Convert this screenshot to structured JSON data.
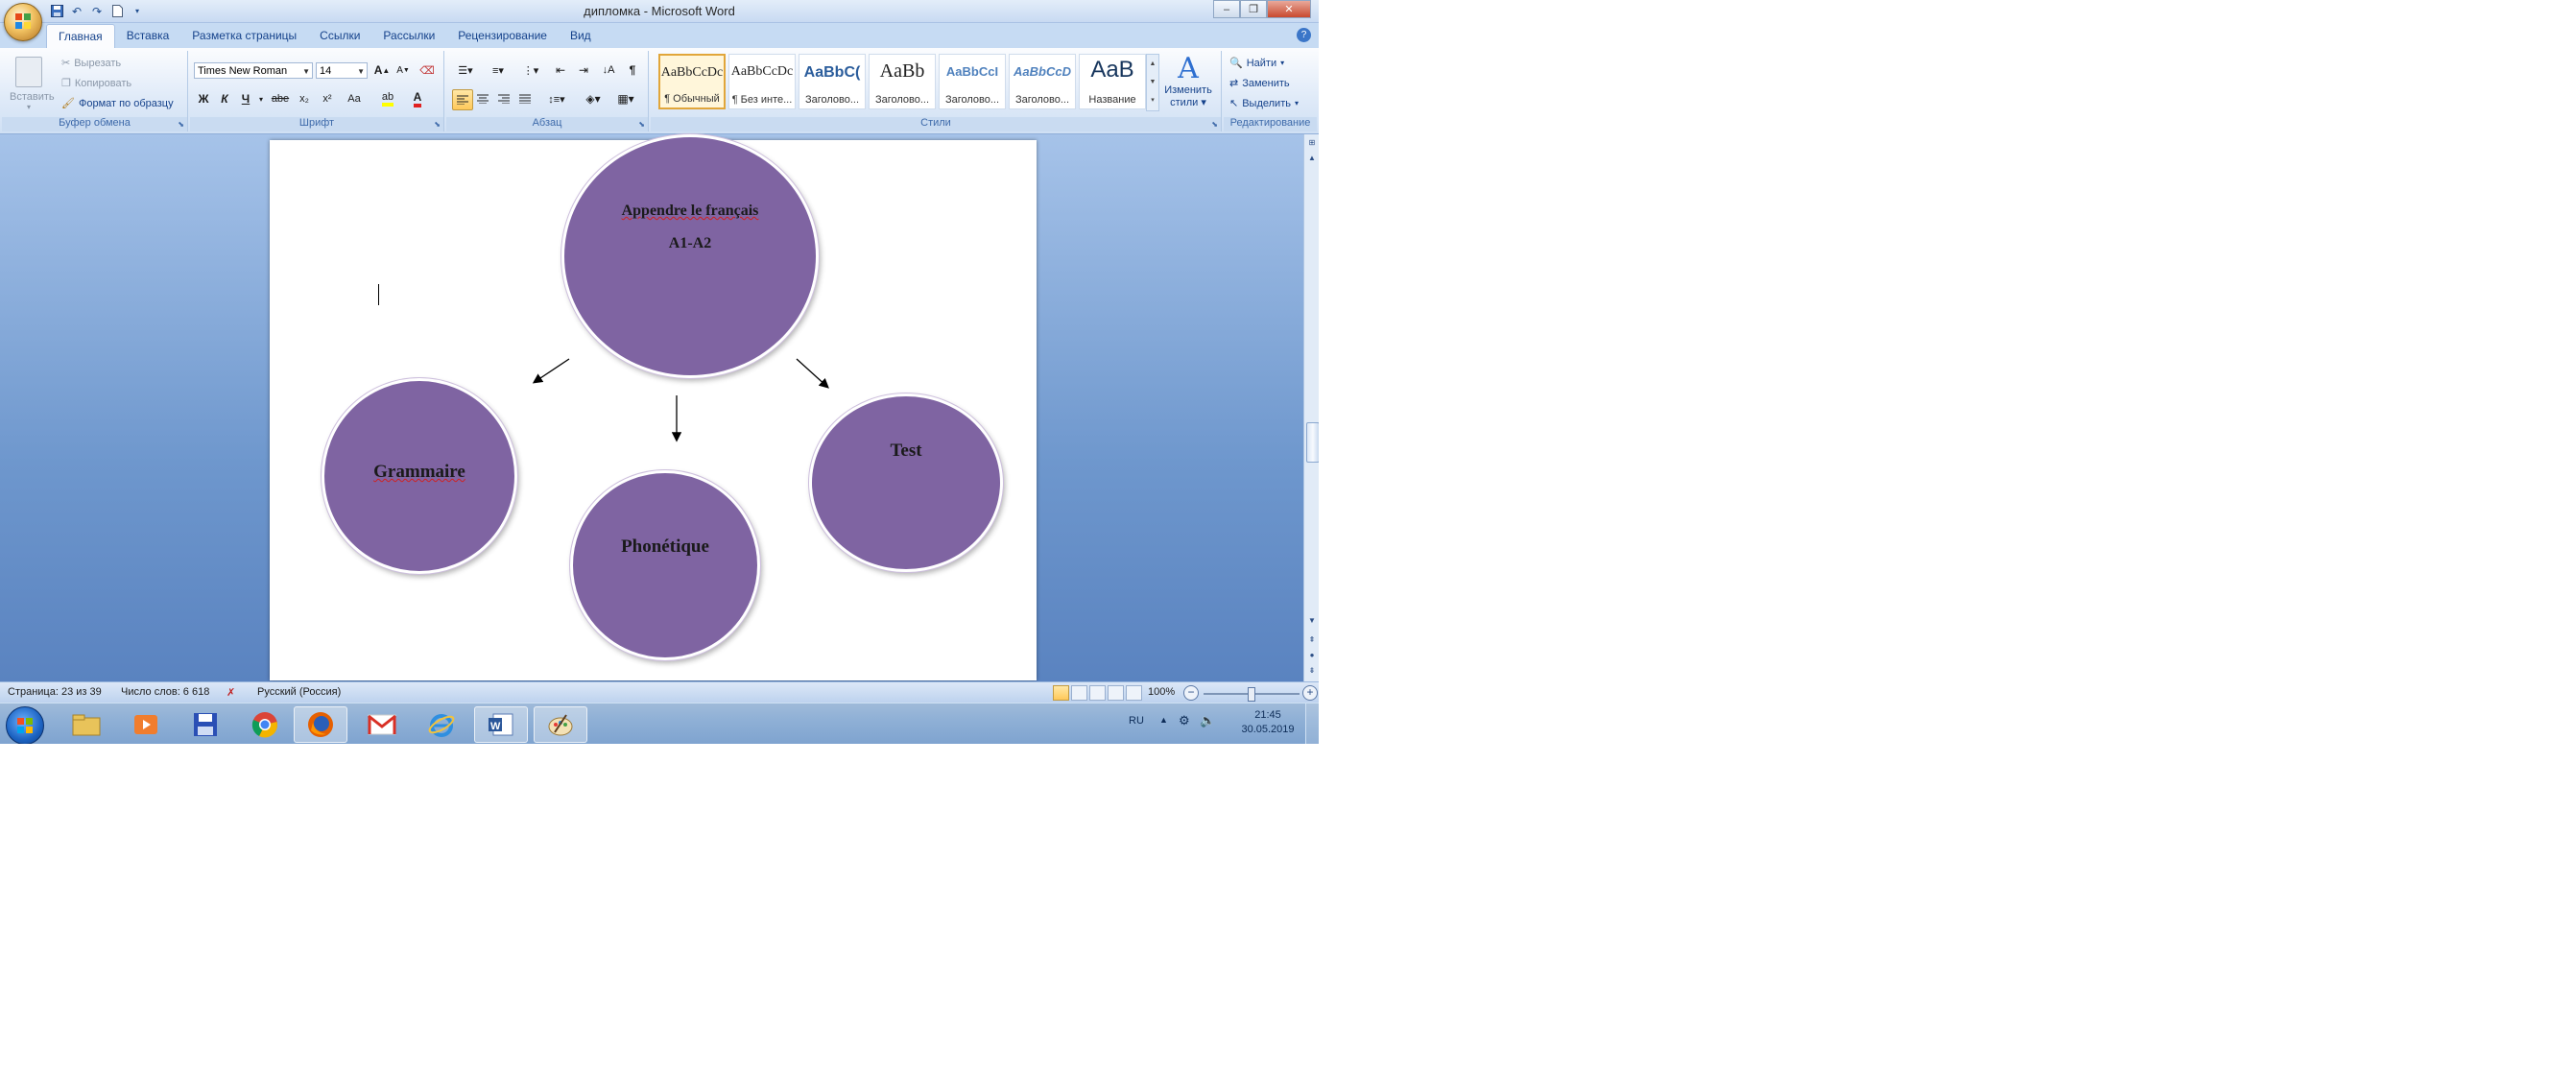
{
  "window": {
    "title": "дипломка - Microsoft Word",
    "controls": {
      "minimize": "–",
      "maximize": "❐",
      "close": "✕"
    }
  },
  "tabs": [
    "Главная",
    "Вставка",
    "Разметка страницы",
    "Ссылки",
    "Рассылки",
    "Рецензирование",
    "Вид"
  ],
  "ribbon": {
    "clipboard": {
      "paste": "Вставить",
      "cut": "Вырезать",
      "copy": "Копировать",
      "format_painter": "Формат по образцу",
      "label": "Буфер обмена"
    },
    "font": {
      "name": "Times New Roman",
      "size": "14",
      "grow": "A",
      "shrink": "A",
      "bold": "Ж",
      "italic": "К",
      "underline": "Ч",
      "strike": "abe",
      "subscript": "x₂",
      "superscript": "x²",
      "case": "Aa",
      "color": "A",
      "label": "Шрифт"
    },
    "paragraph": {
      "label": "Абзац",
      "pilcrow": "¶"
    },
    "styles": {
      "items": [
        {
          "sample": "AaBbCcDc",
          "name": "¶ Обычный"
        },
        {
          "sample": "AaBbCcDc",
          "name": "¶ Без инте..."
        },
        {
          "sample": "AaBbC(",
          "name": "Заголово..."
        },
        {
          "sample": "AaBb",
          "name": "Заголово..."
        },
        {
          "sample": "AaBbCcI",
          "name": "Заголово..."
        },
        {
          "sample": "AaBbCcD",
          "name": "Заголово..."
        },
        {
          "sample": "AaB",
          "name": "Название"
        }
      ],
      "change_line1": "Изменить",
      "change_line2": "стили",
      "label": "Стили"
    },
    "editing": {
      "find": "Найти",
      "replace": "Заменить",
      "select": "Выделить",
      "label": "Редактирование"
    }
  },
  "document": {
    "main_circle": {
      "line1": "Appendre le français",
      "line2": "A1-A2"
    },
    "circles": [
      "Grammaire",
      "Phonétique",
      "Test"
    ]
  },
  "statusbar": {
    "page": "Страница: 23 из 39",
    "words": "Число слов: 6 618",
    "language": "Русский (Россия)",
    "zoom": "100%"
  },
  "taskbar": {
    "apps": [
      "explorer-icon",
      "media-player-icon",
      "floppy-save-icon",
      "chrome-icon",
      "firefox-icon",
      "gmail-icon",
      "internet-explorer-icon",
      "word-icon",
      "paint-icon"
    ],
    "lang": "RU",
    "time": "21:45",
    "date": "30.05.2019"
  },
  "colors": {
    "circle_fill": "#7f64a2",
    "ribbon": "#dfeaf8",
    "workspace": "#6e97cd"
  }
}
